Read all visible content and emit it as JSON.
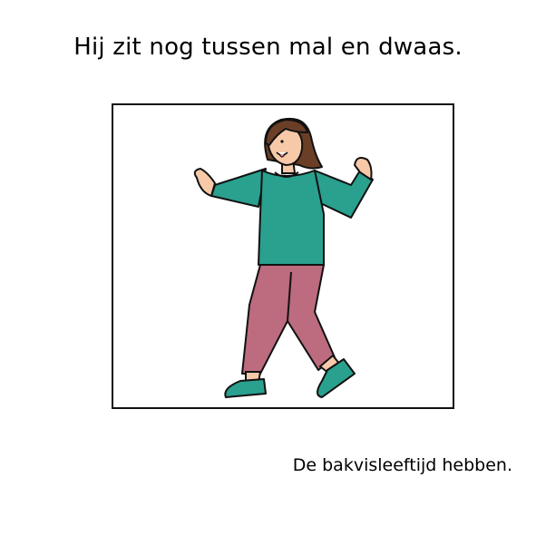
{
  "sentence": "Hij zit nog tussen mal en dwaas.",
  "caption": "De bakvisleeftijd hebben.",
  "colors": {
    "shirt": "#2aa08f",
    "pants": "#bd6b7e",
    "shoes": "#2aa08f",
    "skin": "#f8c9a8",
    "hair": "#6b3e26",
    "outline": "#111111",
    "frame": "#111111"
  }
}
